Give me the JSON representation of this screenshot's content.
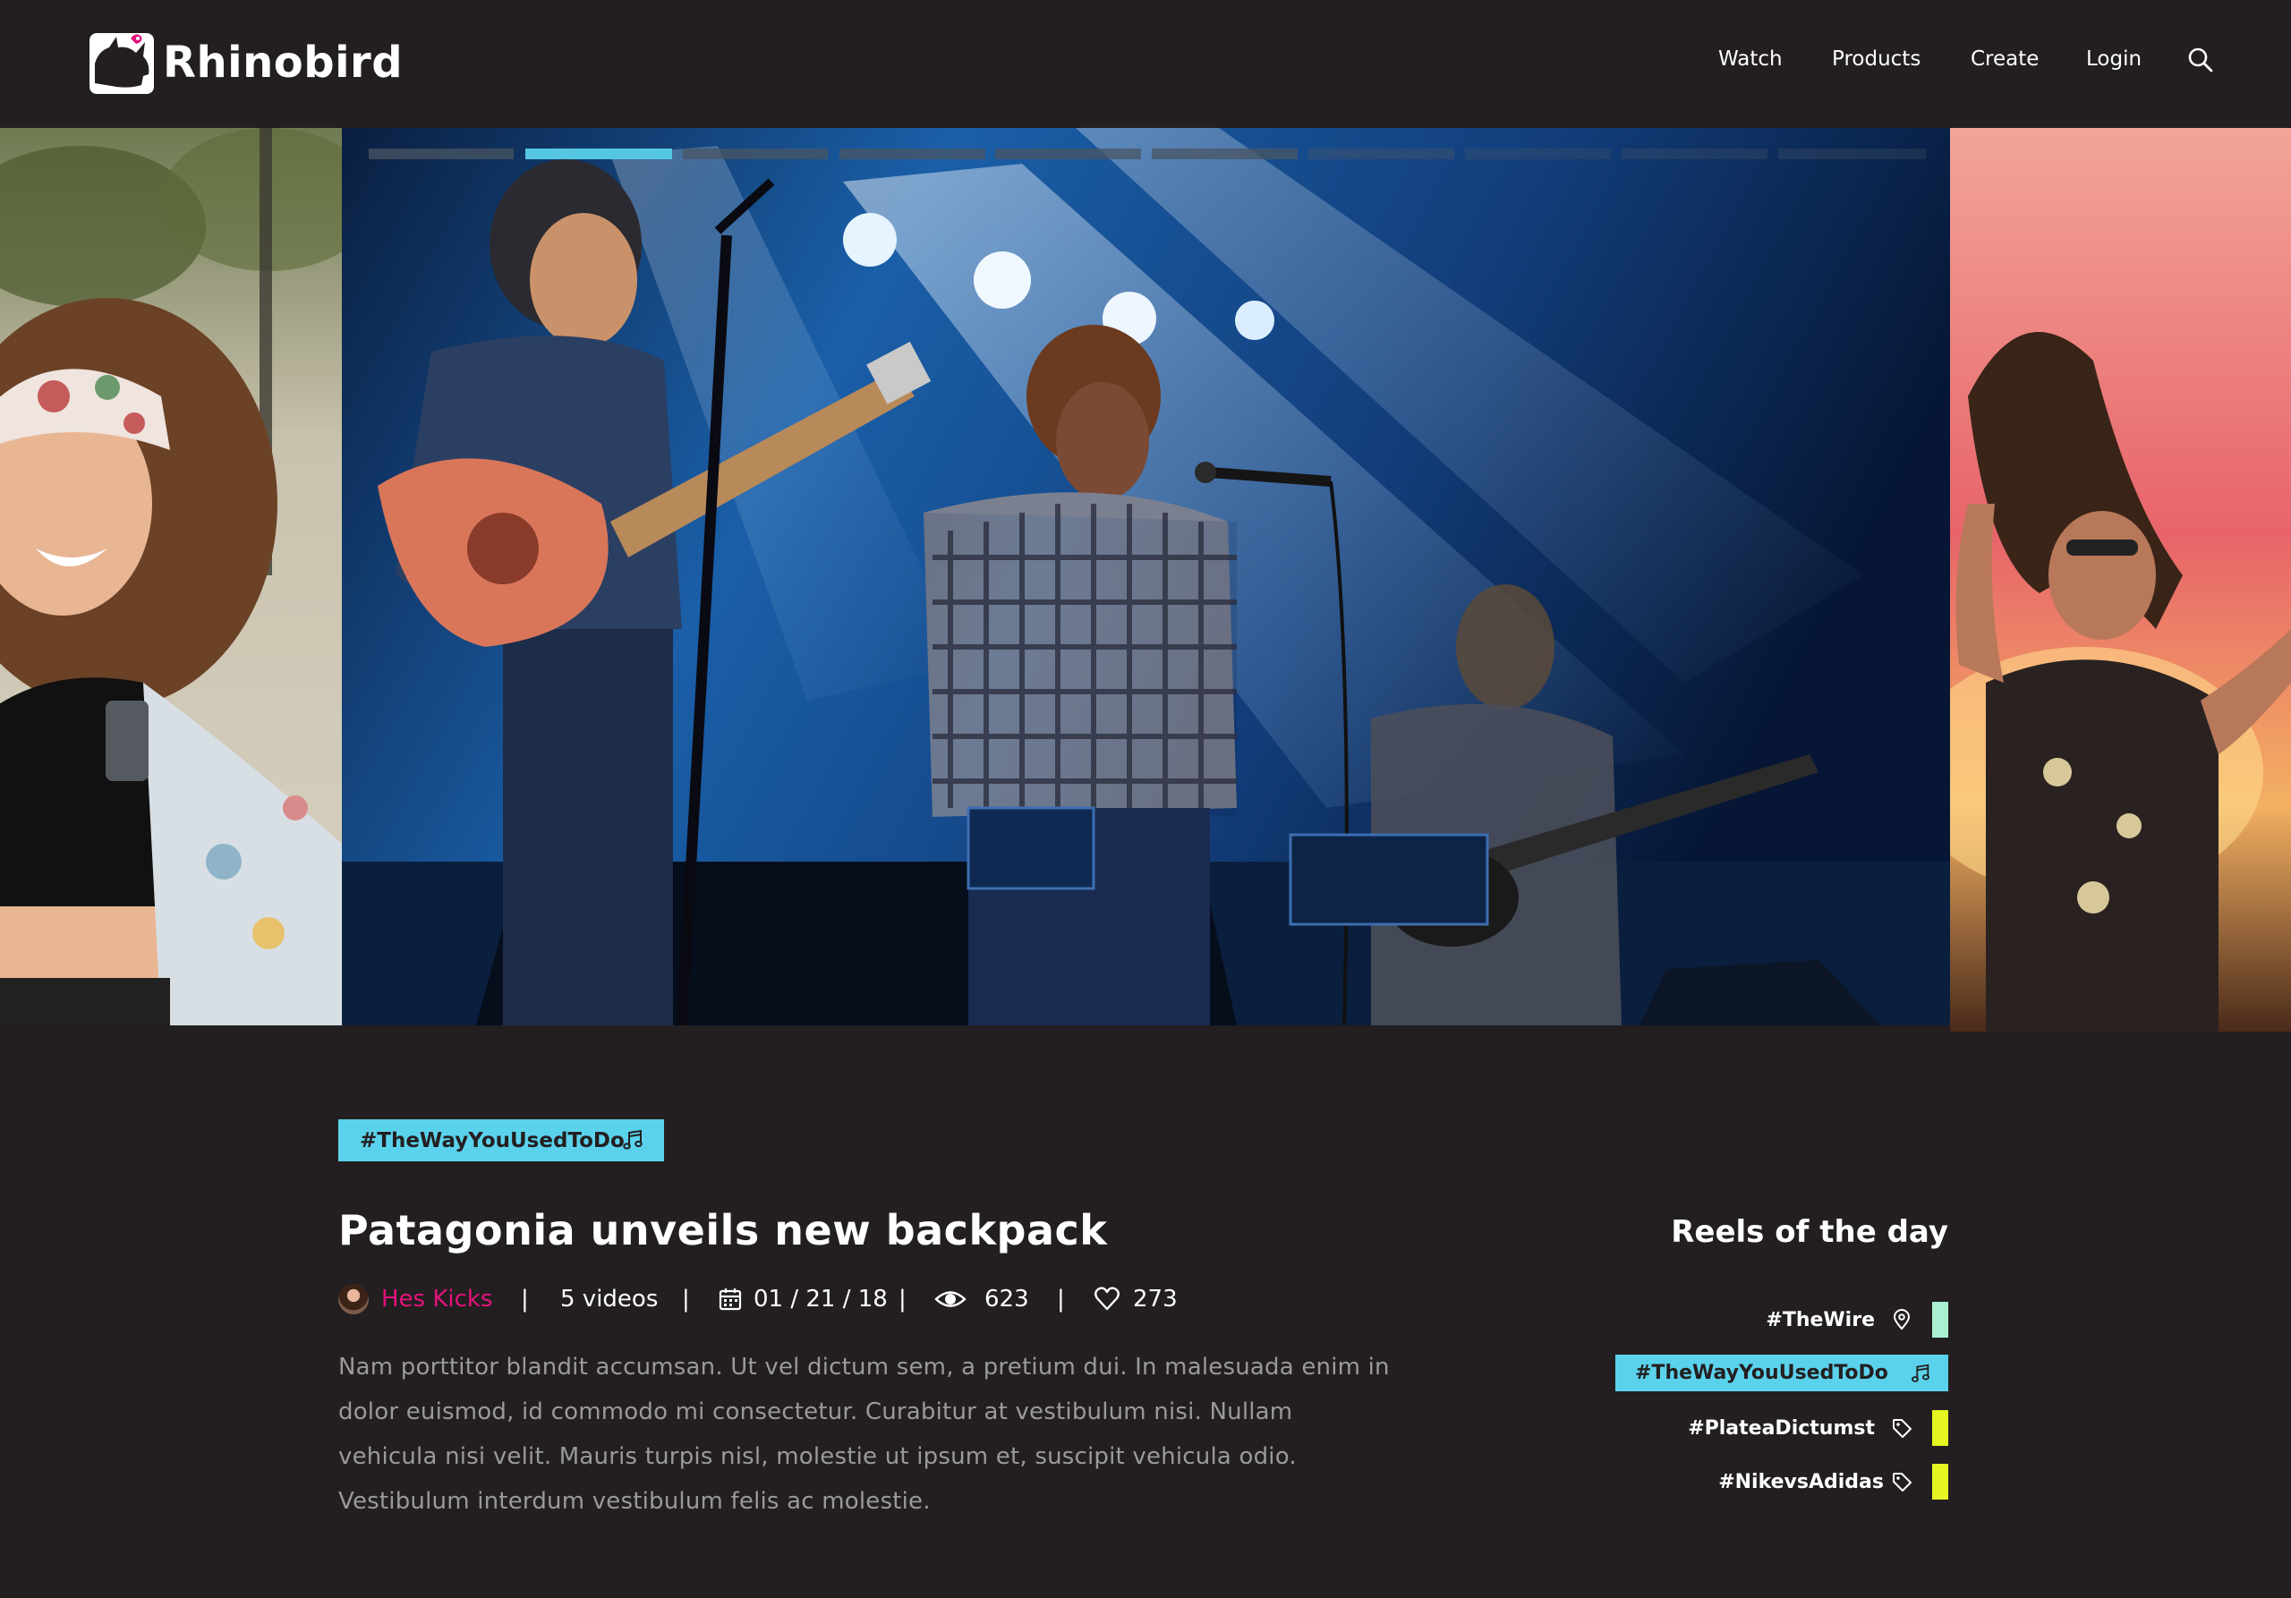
{
  "brand": {
    "name": "Rhinobird"
  },
  "nav": {
    "items": [
      "Watch",
      "Products",
      "Create",
      "Login"
    ]
  },
  "carousel": {
    "slides": [
      {
        "subject": "smiling woman in floral cap at outdoor festival"
      },
      {
        "subject": "band performing on stage under blue lights"
      },
      {
        "subject": "woman dancing against sunset glow"
      }
    ],
    "progress_segments": 10,
    "active_segment": 2
  },
  "article": {
    "tag": {
      "label": "#TheWayYouUsedToDo",
      "icon": "music-note-icon",
      "color": "#5bd2ec"
    },
    "title": "Patagonia unveils new backpack",
    "author": "Hes Kicks",
    "videos": "5 videos",
    "date": "01 / 21 / 18",
    "views": "623",
    "likes": "273",
    "separator": "|",
    "body": "Nam porttitor blandit accumsan. Ut vel dictum sem, a pretium dui. In malesuada enim in dolor euismod, id commodo mi consectetur. Curabitur at vestibulum nisi. Nullam vehicula nisi velit. Mauris turpis nisl, molestie ut ipsum et, suscipit vehicula odio. Vestibulum interdum vestibulum felis ac molestie."
  },
  "reels": {
    "title": "Reels of the day",
    "items": [
      {
        "label": "#TheWire",
        "icon": "location-pin-icon",
        "color": "#a8f0d2",
        "active": false
      },
      {
        "label": "#TheWayYouUsedToDo",
        "icon": "music-note-icon",
        "color": "#5bd2ec",
        "active": true
      },
      {
        "label": "#PlateaDictumst",
        "icon": "tag-icon",
        "color": "#e5f521",
        "active": false
      },
      {
        "label": "#NikevsAdidas",
        "icon": "tag-icon",
        "color": "#e5f521",
        "active": false
      }
    ]
  }
}
